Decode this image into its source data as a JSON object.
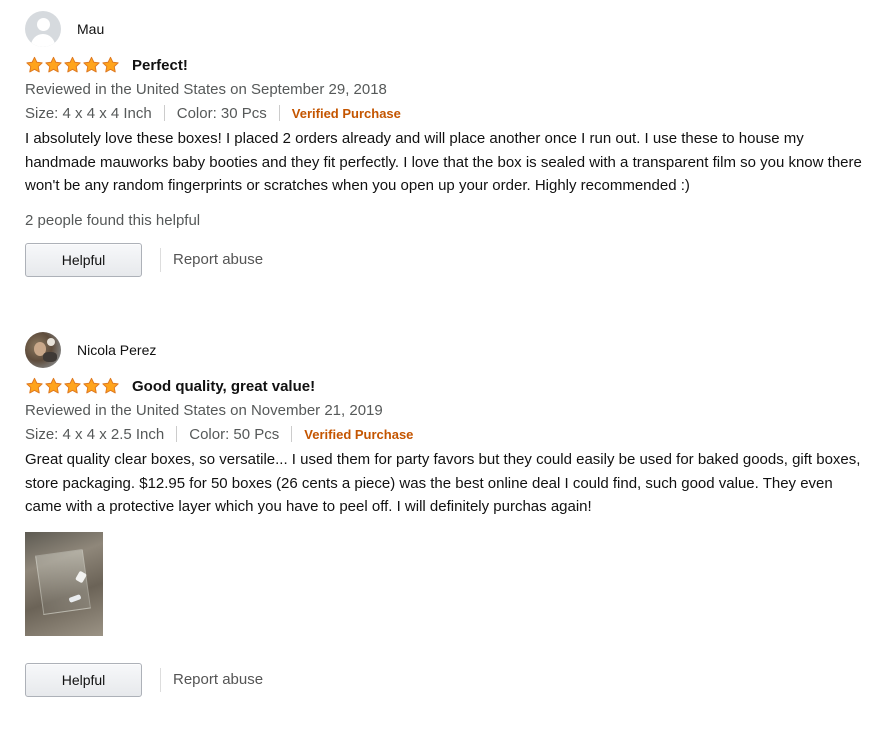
{
  "colors": {
    "star": "#ffa41c",
    "star_outline": "#de7921",
    "verified": "#c45500",
    "secondary_text": "#565959"
  },
  "reviews": [
    {
      "reviewer_name": "Mau",
      "avatar_icon": "default-avatar-icon",
      "rating": 5,
      "title": "Perfect!",
      "date_line": "Reviewed in the United States on September 29, 2018",
      "size": "Size: 4 x 4 x 4 Inch",
      "color": "Color: 30 Pcs",
      "verified": "Verified Purchase",
      "body": "I absolutely love these boxes! I placed 2 orders already and will place another once I run out. I use these to house my handmade mauworks baby booties and they fit perfectly. I love that the box is sealed with a transparent film so you know there won't be any random fingerprints or scratches when you open up your order. Highly recommended :)",
      "helpful_count": "2 people found this helpful",
      "helpful_label": "Helpful",
      "report_label": "Report abuse"
    },
    {
      "reviewer_name": "Nicola Perez",
      "avatar_icon": "profile-photo",
      "rating": 5,
      "title": "Good quality, great value!",
      "date_line": "Reviewed in the United States on November 21, 2019",
      "size": "Size: 4 x 4 x 2.5 Inch",
      "color": "Color: 50 Pcs",
      "verified": "Verified Purchase",
      "body": "Great quality clear boxes, so versatile... I used them for party favors but they could easily be used for baked goods, gift boxes, store packaging. $12.95 for 50 boxes (26 cents a piece) was the best online deal I could find, such good value. They even came with a protective layer which you have to peel off. I will definitely purchas again!",
      "has_image": true,
      "helpful_label": "Helpful",
      "report_label": "Report abuse"
    }
  ]
}
